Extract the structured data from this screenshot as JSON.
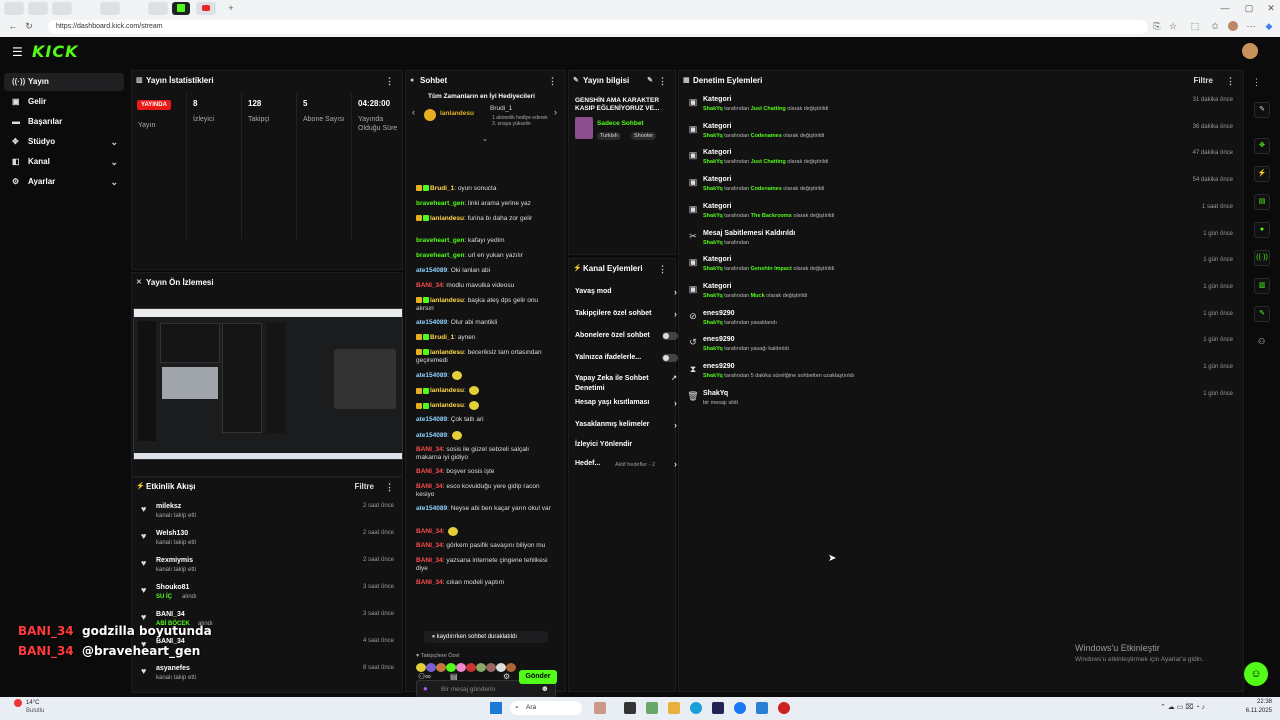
{
  "browser": {
    "url": "https://dashboard.kick.com/stream"
  },
  "header": {
    "logo": "KICK"
  },
  "sidebar": {
    "items": [
      {
        "label": "Yayın",
        "icon": "broadcast-icon"
      },
      {
        "label": "Gelir",
        "icon": "money-icon"
      },
      {
        "label": "Başarılar",
        "icon": "trophy-icon"
      },
      {
        "label": "Stüdyo",
        "icon": "studio-icon"
      },
      {
        "label": "Kanal",
        "icon": "channel-icon"
      },
      {
        "label": "Ayarlar",
        "icon": "gear-icon"
      }
    ]
  },
  "stats": {
    "title": "Yayın İstatistikleri",
    "live_badge": "YAYINDA",
    "live_label": "Yayın",
    "viewers_val": "8",
    "viewers_lbl": "İzleyici",
    "followers_val": "128",
    "followers_lbl": "Takipçi",
    "subs_val": "5",
    "subs_lbl": "Abone Sayısı",
    "uptime_val": "04:28:00",
    "uptime_lbl": "Yayında Olduğu Süre"
  },
  "preview": {
    "title": "Yayın Ön İzlemesi"
  },
  "activity": {
    "title": "Etkinlik Akışı",
    "filter": "Filtre",
    "items": [
      {
        "name": "mileksz",
        "action": "kanalı takip etti",
        "time": "2 saat önce",
        "green": false
      },
      {
        "name": "Welsh130",
        "action": "kanalı takip etti",
        "time": "2 saat önce",
        "green": false
      },
      {
        "name": "Rexmiymis",
        "action": "kanalı takip etti",
        "time": "2 saat önce",
        "green": false
      },
      {
        "name": "Shouko81",
        "action": "SU İÇ",
        "action2": "alındı",
        "time": "3 saat önce",
        "green": true
      },
      {
        "name": "BANI_34",
        "action": "ABİ BÖCEK",
        "action2": "alındı",
        "time": "3 saat önce",
        "green": true
      },
      {
        "name": "BANI_34",
        "action": "",
        "time": "4 saat önce",
        "green": false
      },
      {
        "name": "asyanefes",
        "action": "kanalı takip etti",
        "time": "8 saat önce",
        "green": false
      }
    ]
  },
  "chat": {
    "title": "Sohbet",
    "gift_title": "Tüm Zamanların en İyi Hediyecileri",
    "gifter1": "lanlandesu",
    "gifter2": "Brudi_1",
    "gifter2_note": "1 abonelik hediye ederek 3. sıraya yükselin",
    "paused": "kaydırırken sohbet duraklatıldı",
    "followers_only": "Takipçilere Özel",
    "input_placeholder": "Bir mesaj gönderin",
    "send": "Gönder",
    "messages": [
      {
        "user": "Brudi_1",
        "cls": "u-yel",
        "text": ": oyun sonucta"
      },
      {
        "user": "braveheart_gen",
        "cls": "u-green",
        "text": ": linki arama yerine yaz"
      },
      {
        "user": "lanlandesu",
        "cls": "u-yel",
        "text": ": furina bı daha zor gelir"
      },
      {
        "user": "braveheart_gen",
        "cls": "u-green",
        "text": ": kafayı yedim"
      },
      {
        "user": "braveheart_gen",
        "cls": "u-green",
        "text": ": url en yukarı yazılır"
      },
      {
        "user": "ate154089",
        "cls": "u-blue",
        "text": ": Oki lanlan abi"
      },
      {
        "user": "BANI_34",
        "cls": "u-red",
        "text": ": modlu mavulka videosu"
      },
      {
        "user": "lanlandesu",
        "cls": "u-yel",
        "text": ": başka ateş dps gelir onu alırsın"
      },
      {
        "user": "ate154089",
        "cls": "u-blue",
        "text": ": Olur abi mantikli"
      },
      {
        "user": "Brudi_1",
        "cls": "u-yel",
        "text": ": aynen"
      },
      {
        "user": "lanlandesu",
        "cls": "u-yel",
        "text": ": beceriksiz tam ortasından geçiremedi"
      },
      {
        "user": "ate154089",
        "cls": "u-blue",
        "text": ":"
      },
      {
        "user": "lanlandesu",
        "cls": "u-yel",
        "text": ":"
      },
      {
        "user": "lanlandesu",
        "cls": "u-yel",
        "text": ":"
      },
      {
        "user": "ate154089",
        "cls": "u-blue",
        "text": ": Çok tatlı ari"
      },
      {
        "user": "ate154089",
        "cls": "u-blue",
        "text": ":"
      },
      {
        "user": "BANI_34",
        "cls": "u-red",
        "text": ": sosis ile güzel sebzeli salçalı makarna iyi gidiyo"
      },
      {
        "user": "BANI_34",
        "cls": "u-red",
        "text": ": boşver sosis işte"
      },
      {
        "user": "BANI_34",
        "cls": "u-red",
        "text": ": esco kovulduğu yere gidip racon kesiyo"
      },
      {
        "user": "ate154089",
        "cls": "u-blue",
        "text": ": Neyse abi ben kaçar yarın okul var"
      },
      {
        "user": "BANI_34",
        "cls": "u-red",
        "text": ":"
      },
      {
        "user": "BANI_34",
        "cls": "u-red",
        "text": ": görkem pasifik savaşını biliyon mu"
      },
      {
        "user": "BANI_34",
        "cls": "u-red",
        "text": ": yazsana internete çingene tehlikesi diye"
      },
      {
        "user": "BANI_34",
        "cls": "u-red",
        "text": ": cıkan modeli yaptım"
      }
    ]
  },
  "stream_info": {
    "title": "Yayın bilgisi",
    "stream_title": "GENSHİN AMA KARAKTER KASIP EĞLENİYORUZ VE...",
    "category": "Sadece Sohbet",
    "tags": [
      "Turkish",
      "Shooter"
    ]
  },
  "channel_actions": {
    "title": "Kanal Eylemleri",
    "items": [
      {
        "label": "Yavaş mod",
        "type": "arrow"
      },
      {
        "label": "Takipçilere özel sohbet",
        "type": "arrow"
      },
      {
        "label": "Abonelere özel sohbet",
        "type": "toggle"
      },
      {
        "label": "Yalnızca ifadelerle...",
        "type": "toggle"
      },
      {
        "label": "Yapay Zeka ile Sohbet Denetimi",
        "type": "ext"
      },
      {
        "label": "Hesap yaşı kısıtlaması",
        "type": "arrow"
      },
      {
        "label": "Yasaklanmış kelimeler",
        "type": "arrow"
      },
      {
        "label": "İzleyici Yönlendir",
        "type": "none"
      },
      {
        "label": "Hedef...",
        "type": "arrow",
        "extra": "Aktif hedefler - 2"
      }
    ]
  },
  "moderation": {
    "title": "Denetim Eylemleri",
    "filter": "Filtre",
    "items": [
      {
        "icon": "category-icon",
        "title": "Kategori",
        "actor": "ShakYq",
        "mid": " tarafından ",
        "target": "Just Chatting",
        "end": " olarak değiştirildi",
        "time": "31 dakika önce"
      },
      {
        "icon": "category-icon",
        "title": "Kategori",
        "actor": "ShakYq",
        "mid": " tarafından ",
        "target": "Codenames",
        "end": " olarak değiştirildi",
        "time": "36 dakika önce"
      },
      {
        "icon": "category-icon",
        "title": "Kategori",
        "actor": "ShakYq",
        "mid": " tarafından ",
        "target": "Just Chatting",
        "end": " olarak değiştirildi",
        "time": "47 dakika önce"
      },
      {
        "icon": "category-icon",
        "title": "Kategori",
        "actor": "ShakYq",
        "mid": " tarafından ",
        "target": "Codenames",
        "end": " olarak değiştirildi",
        "time": "54 dakika önce"
      },
      {
        "icon": "category-icon",
        "title": "Kategori",
        "actor": "ShakYq",
        "mid": " tarafından ",
        "target": "The Backrooms",
        "end": " olarak değiştirildi",
        "time": "1 saat önce"
      },
      {
        "icon": "unpin-icon",
        "title": "Mesaj Sabitlemesi Kaldırıldı",
        "actor": "ShakYq",
        "mid": " tarafından",
        "target": "",
        "end": "",
        "time": "1 gün önce"
      },
      {
        "icon": "category-icon",
        "title": "Kategori",
        "actor": "ShakYq",
        "mid": " tarafından ",
        "target": "Genshin Impact",
        "end": " olarak değiştirildi",
        "time": "1 gün önce"
      },
      {
        "icon": "category-icon",
        "title": "Kategori",
        "actor": "ShakYq",
        "mid": " tarafından ",
        "target": "Muck",
        "end": " olarak değiştirildi",
        "time": "1 gün önce"
      },
      {
        "icon": "ban-icon",
        "title": "enes9290",
        "actor": "ShakYq",
        "mid": " tarafından yasaklandı",
        "target": "",
        "end": "",
        "time": "1 gün önce"
      },
      {
        "icon": "unban-icon",
        "title": "enes9290",
        "actor": "ShakYq",
        "mid": " tarafından yasağı kaldırıldı",
        "target": "",
        "end": "",
        "time": "1 gün önce"
      },
      {
        "icon": "timeout-icon",
        "title": "enes9290",
        "actor": "ShakYq",
        "mid": " tarafından 5 dakika süreliğine sohbetten uzaklaştırıldı",
        "target": "",
        "end": "",
        "time": "1 gün önce"
      },
      {
        "icon": "trash-icon",
        "title": "ShakYq",
        "actor": "",
        "mid": "bir mesajı sildi",
        "target": "",
        "end": "",
        "time": "1 gün önce"
      }
    ]
  },
  "overlay": {
    "line1_user": "BANI_34",
    "line1_text": "godzilla boyutunda",
    "line2_user": "BANI_34",
    "line2_text": "@braveheart_gen"
  },
  "windows": {
    "activate_title": "Windows'u Etkinleştir",
    "activate_sub": "Windows'u etkinleştirmek için Ayarlar'a gidin.",
    "weather_temp": "14°C",
    "weather_desc": "Bulutlu",
    "search": "Ara",
    "time": "22:38",
    "date": "6.11.2025"
  },
  "colors": {
    "accent": "#53fc18",
    "live": "#e91916",
    "bg": "#0b0b0c",
    "panel": "#121213"
  }
}
